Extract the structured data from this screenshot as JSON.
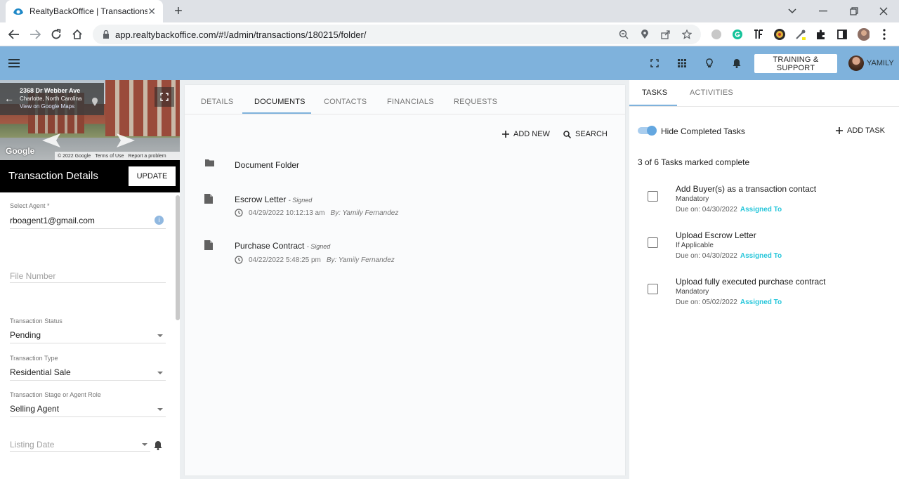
{
  "browser": {
    "tab_title": "RealtyBackOffice | Transactions",
    "url": "app.realtybackoffice.com/#!/admin/transactions/180215/folder/"
  },
  "header": {
    "training_label": "TRAINING & SUPPORT",
    "user_name": "YAMILY"
  },
  "streetview": {
    "address": "2368 Dr Webber Ave",
    "city": "Charlotte, North Carolina",
    "link": "View on Google Maps",
    "brand": "Google",
    "credits": [
      "© 2022 Google",
      "Terms of Use",
      "Report a problem"
    ]
  },
  "transaction": {
    "title": "Transaction Details",
    "update_label": "UPDATE",
    "fields": {
      "agent_label": "Select Agent *",
      "agent_value": "rboagent1@gmail.com",
      "file_number_placeholder": "File Number",
      "status_label": "Transaction Status",
      "status_value": "Pending",
      "type_label": "Transaction Type",
      "type_value": "Residential Sale",
      "stage_label": "Transaction Stage or Agent Role",
      "stage_value": "Selling Agent",
      "listing_date_placeholder": "Listing Date"
    }
  },
  "center": {
    "tabs": [
      "DETAILS",
      "DOCUMENTS",
      "CONTACTS",
      "FINANCIALS",
      "REQUESTS"
    ],
    "add_new_label": "ADD NEW",
    "search_label": "SEARCH",
    "folder_name": "Document Folder",
    "documents": [
      {
        "name": "Escrow Letter",
        "tag": "- Signed",
        "date": "04/29/2022 10:12:13 am",
        "by": "By: Yamily Fernandez"
      },
      {
        "name": "Purchase Contract",
        "tag": "- Signed",
        "date": "04/22/2022 5:48:25 pm",
        "by": "By: Yamily Fernandez"
      }
    ]
  },
  "right": {
    "tabs": [
      "TASKS",
      "ACTIVITIES"
    ],
    "hide_completed_label": "Hide Completed Tasks",
    "add_task_label": "ADD TASK",
    "task_count": "3 of 6 Tasks marked complete",
    "tasks": [
      {
        "title": "Add Buyer(s) as a transaction contact",
        "type": "Mandatory",
        "due": "Due on: 04/30/2022",
        "assigned": "Assigned To"
      },
      {
        "title": "Upload Escrow Letter",
        "type": "If Applicable",
        "due": "Due on: 04/30/2022",
        "assigned": "Assigned To"
      },
      {
        "title": "Upload fully executed purchase contract",
        "type": "Mandatory",
        "due": "Due on: 05/02/2022",
        "assigned": "Assigned To"
      }
    ]
  },
  "colors": {
    "header_bg": "#7fb2dc",
    "accent_teal": "#26c6da",
    "tab_indicator": "#7fb2dc"
  }
}
